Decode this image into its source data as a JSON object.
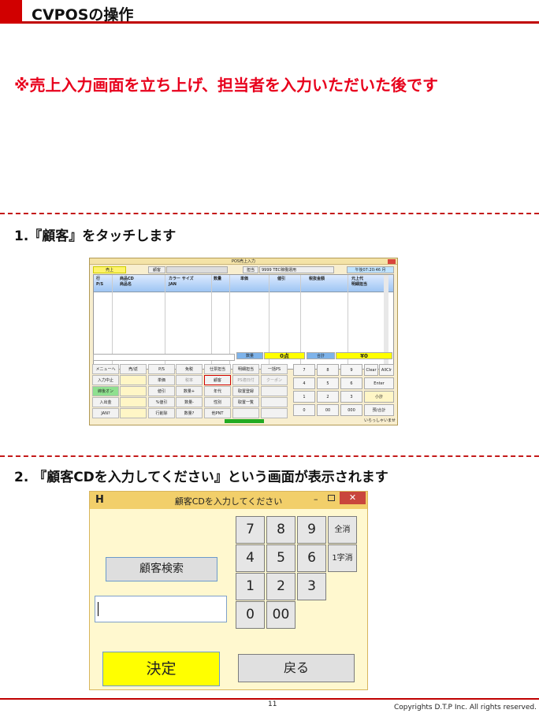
{
  "header": {
    "title": "CVPOSの操作"
  },
  "notice": "※売上入力画面を立ち上げ、担当者を入力いただいた後です",
  "steps": [
    {
      "label": "1.『顧客』をタッチします"
    },
    {
      "label": "2. 『顧客CDを入力してください』という画面が表示されます"
    }
  ],
  "pos": {
    "window_title": "POS売上入力",
    "mode": "売上",
    "customer_label": "顧客",
    "staff_label": "担当",
    "staff_value": "9999 TEC稼働運用",
    "clock": "午後07:20:46 月",
    "columns": [
      "行\nP/S",
      "商品CD\n商品名",
      "カラー サイズ\nJAN",
      "数量",
      "単価",
      "値引",
      "税抜金額",
      "元上代\n明細担当"
    ],
    "qty_label": "数量",
    "qty_value": "0点",
    "total_label": "合計",
    "total_value": "¥0",
    "func_col1": [
      "メニューへ",
      "入力中止",
      "締後オン",
      "入出金",
      "JAN?"
    ],
    "func_col2": [
      "売/返",
      "",
      "",
      "",
      ""
    ],
    "func_rows": [
      [
        "P/S",
        "免税",
        "仕票担当",
        "明細担当",
        "一括PS"
      ],
      [
        "単価",
        "税率",
        "顧客",
        "PS適日付",
        "クーポン"
      ],
      [
        "値引",
        "数量+",
        "年代",
        "取置登録",
        ""
      ],
      [
        "%値引",
        "数量-",
        "性別",
        "取置一覧",
        ""
      ],
      [
        "行削除",
        "数量?",
        "他PNT",
        "",
        ""
      ]
    ],
    "keypad": [
      [
        "7",
        "8",
        "9",
        "Clear",
        "AllClr"
      ],
      [
        "4",
        "5",
        "6",
        "Enter"
      ],
      [
        "1",
        "2",
        "3",
        "小計"
      ],
      [
        "0",
        "00",
        "000",
        "預/合計"
      ]
    ],
    "welcome": "いらっしゃいませ"
  },
  "dialog": {
    "app_icon": "H",
    "title": "顧客CDを入力してください",
    "minimize": "–",
    "close": "✕",
    "search_button": "顧客検索",
    "input_value": "",
    "keys": [
      "7",
      "8",
      "9",
      "全消",
      "4",
      "5",
      "6",
      "1字消",
      "1",
      "2",
      "3",
      "0",
      "00"
    ],
    "ok_button": "決定",
    "back_button": "戻る"
  },
  "footer": {
    "page": "11",
    "copyright": "Copyrights  D.T.P Inc. All rights reserved."
  },
  "colors": {
    "brand_red": "#c00000",
    "notice_red": "#e8001c",
    "confirm_yellow": "#ffff00",
    "dialog_titlebar": "#f2cf6a"
  }
}
